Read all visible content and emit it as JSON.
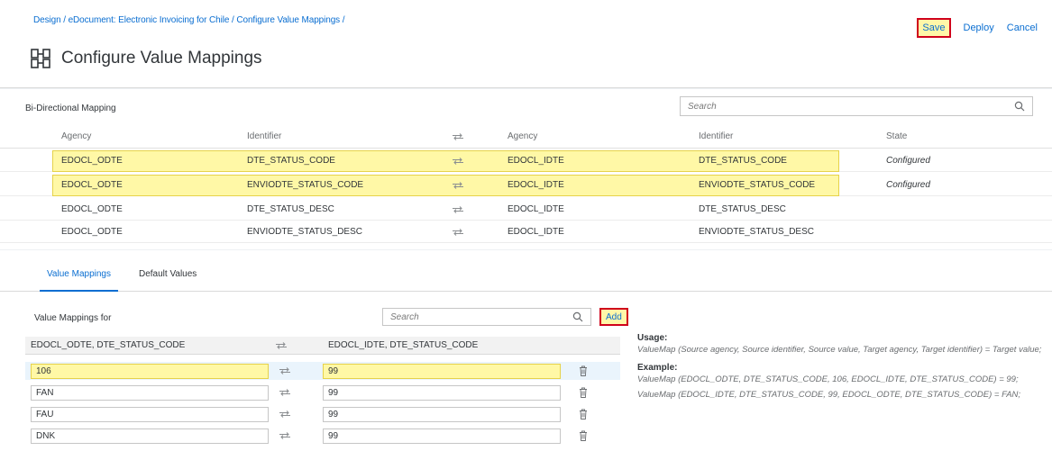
{
  "header": {
    "breadcrumb": "Design / eDocument: Electronic Invoicing for Chile / Configure Value Mappings /",
    "title": "Configure Value Mappings",
    "actions": {
      "save": "Save",
      "deploy": "Deploy",
      "cancel": "Cancel"
    }
  },
  "bidirectional": {
    "label": "Bi-Directional Mapping",
    "search_placeholder": "Search",
    "columns": {
      "agency1": "Agency",
      "identifier1": "Identifier",
      "agency2": "Agency",
      "identifier2": "Identifier",
      "state": "State"
    },
    "rows": [
      {
        "agency1": "EDOCL_ODTE",
        "identifier1": "DTE_STATUS_CODE",
        "agency2": "EDOCL_IDTE",
        "identifier2": "DTE_STATUS_CODE",
        "state": "Configured"
      },
      {
        "agency1": "EDOCL_ODTE",
        "identifier1": "ENVIODTE_STATUS_CODE",
        "agency2": "EDOCL_IDTE",
        "identifier2": "ENVIODTE_STATUS_CODE",
        "state": "Configured"
      },
      {
        "agency1": "EDOCL_ODTE",
        "identifier1": "DTE_STATUS_DESC",
        "agency2": "EDOCL_IDTE",
        "identifier2": "DTE_STATUS_DESC",
        "state": ""
      },
      {
        "agency1": "EDOCL_ODTE",
        "identifier1": "ENVIODTE_STATUS_DESC",
        "agency2": "EDOCL_IDTE",
        "identifier2": "ENVIODTE_STATUS_DESC",
        "state": ""
      }
    ]
  },
  "tabs": {
    "value_mappings": "Value Mappings",
    "default_values": "Default Values"
  },
  "value_mappings": {
    "label": "Value Mappings for",
    "search_placeholder": "Search",
    "add": "Add",
    "columns": {
      "source": "EDOCL_ODTE, DTE_STATUS_CODE",
      "target": "EDOCL_IDTE, DTE_STATUS_CODE"
    },
    "rows": [
      {
        "source": "106",
        "target": "99"
      },
      {
        "source": "FAN",
        "target": "99"
      },
      {
        "source": "FAU",
        "target": "99"
      },
      {
        "source": "DNK",
        "target": "99"
      }
    ]
  },
  "usage": {
    "usage_title": "Usage:",
    "usage_text": "ValueMap (Source agency, Source identifier, Source value, Target agency, Target identifier) = Target value;",
    "example_title": "Example:",
    "example1": "ValueMap (EDOCL_ODTE, DTE_STATUS_CODE, 106, EDOCL_IDTE, DTE_STATUS_CODE) = 99;",
    "example2": "ValueMap (EDOCL_IDTE, DTE_STATUS_CODE, 99, EDOCL_ODTE, DTE_STATUS_CODE) = FAN;"
  },
  "colors": {
    "accent": "#0a6ed1",
    "highlight": "#fff8a6",
    "configured": "#107e3e",
    "red_frame": "#d0021b"
  }
}
